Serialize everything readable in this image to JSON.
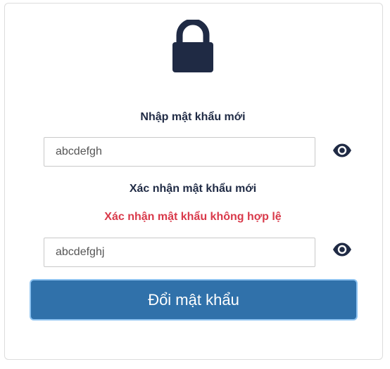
{
  "colors": {
    "icon": "#1f2a44",
    "label": "#1f2a44",
    "error": "#d9394a",
    "button_bg": "#3071aa",
    "button_border": "#8ec3f0"
  },
  "icons": {
    "lock": "lock-icon",
    "eye": "eye-icon"
  },
  "form": {
    "new_password_label": "Nhập mật khẩu mới",
    "new_password_value": "abcdefgh",
    "confirm_password_label": "Xác nhận mật khẩu mới",
    "confirm_error": "Xác nhận mật khẩu không hợp lệ",
    "confirm_password_value": "abcdefghj",
    "submit_label": "Đổi mật khẩu"
  }
}
